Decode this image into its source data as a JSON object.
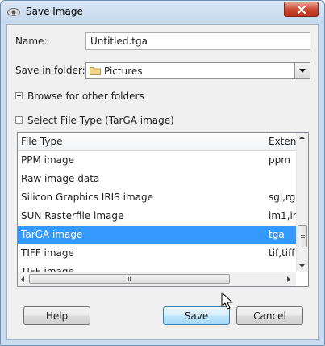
{
  "window": {
    "title": "Save Image",
    "close_icon": "close-icon"
  },
  "form": {
    "name_label": "Name:",
    "name_value": "Untitled.tga",
    "folder_label": "Save in folder:",
    "folder_value": "Pictures",
    "browse_label": "Browse for other folders",
    "filetype_label": "Select File Type (TarGA image)"
  },
  "filetype_list": {
    "columns": [
      "File Type",
      "Extens"
    ],
    "rows": [
      {
        "type": "PPM image",
        "ext": "ppm"
      },
      {
        "type": "Raw image data",
        "ext": ""
      },
      {
        "type": "Silicon Graphics IRIS image",
        "ext": "sgi,rg"
      },
      {
        "type": "SUN Rasterfile image",
        "ext": "im1,ir"
      },
      {
        "type": "TarGA image",
        "ext": "tga"
      },
      {
        "type": "TIFF image",
        "ext": "tif,tiff"
      },
      {
        "type": "TIFF image",
        "ext": ""
      }
    ],
    "selected_index": 4
  },
  "buttons": {
    "help": "Help",
    "save": "Save",
    "cancel": "Cancel"
  },
  "colors": {
    "selection": "#3399ff",
    "titlebar": "#c9dcef",
    "close_button": "#c7462d"
  }
}
